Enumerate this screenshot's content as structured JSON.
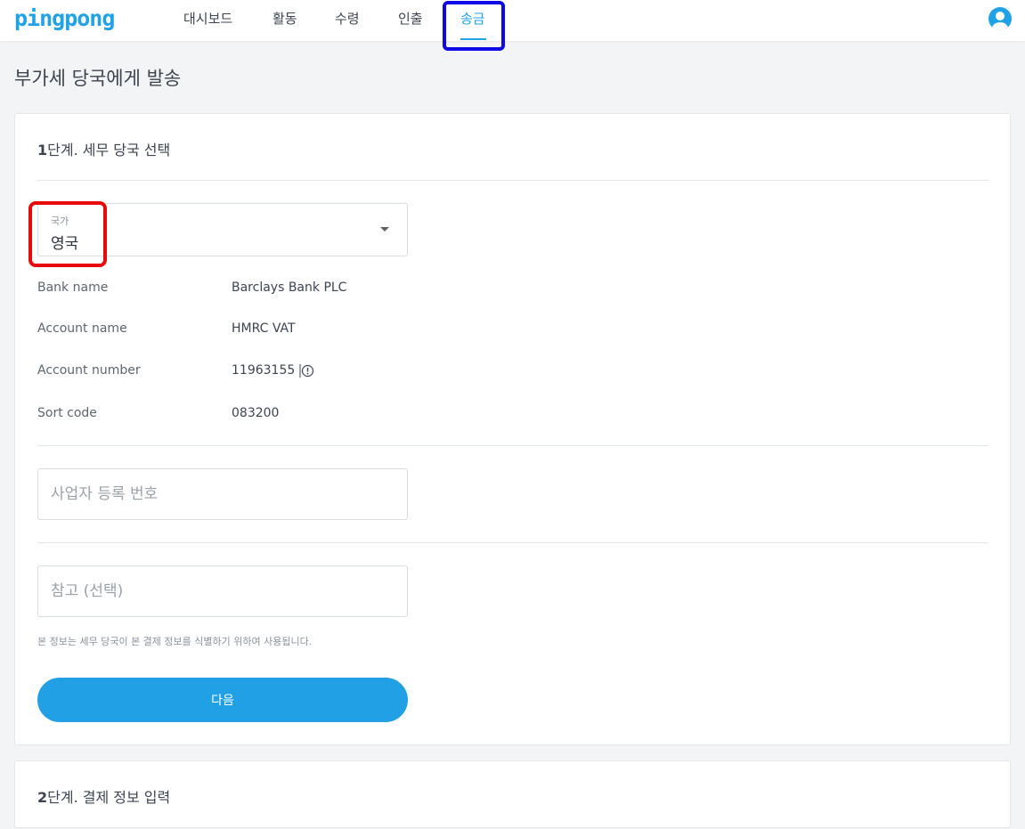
{
  "header": {
    "logo": "pingpong",
    "nav": [
      {
        "label": "대시보드"
      },
      {
        "label": "활동"
      },
      {
        "label": "수령"
      },
      {
        "label": "인출"
      },
      {
        "label": "송금"
      }
    ],
    "active_nav": "송금"
  },
  "page": {
    "title": "부가세 당국에게 발송"
  },
  "step1": {
    "number": "1",
    "title": "단계. 세무 당국 선택",
    "country_select": {
      "label": "국가",
      "value": "영국"
    },
    "bank_info": [
      {
        "label": "Bank name",
        "value": "Barclays Bank PLC"
      },
      {
        "label": "Account name",
        "value": "HMRC VAT"
      },
      {
        "label": "Account number",
        "value": "11963155"
      },
      {
        "label": "Sort code",
        "value": "083200"
      }
    ],
    "business_number": {
      "value": "",
      "placeholder": "사업자 등록 번호"
    },
    "reference": {
      "value": "",
      "placeholder": "참고 (선택)"
    },
    "note": "본 정보는 세무 당국이 본 결제 정보를 식별하기 위하여 사용됩니다.",
    "next_button": "다음"
  },
  "step2": {
    "number": "2",
    "title": "단계. 결제 정보 입력"
  },
  "colors": {
    "accent": "#1fa3e6",
    "highlight_blue": "#0c08e6",
    "highlight_red": "#e60a0a"
  },
  "icons": {
    "user": "user-avatar-icon",
    "dropdown": "chevron-down-icon",
    "info": "info-icon"
  }
}
